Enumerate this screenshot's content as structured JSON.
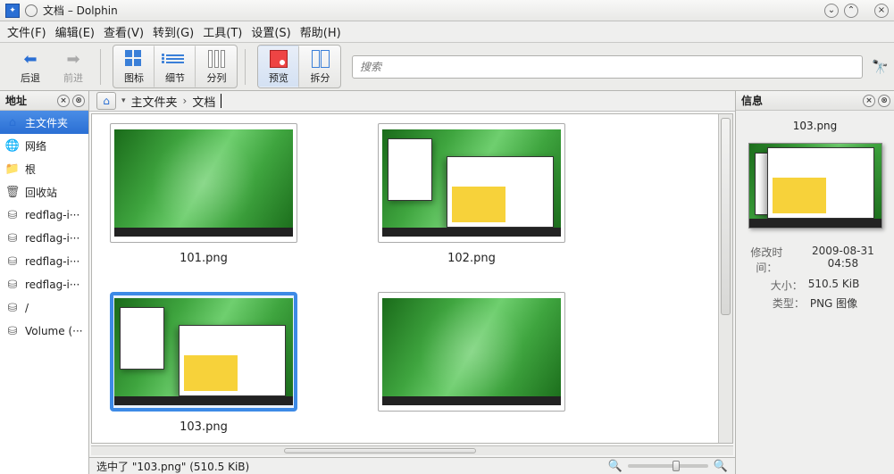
{
  "titlebar": {
    "title": "文档 – Dolphin"
  },
  "menu": {
    "file": "文件(F)",
    "edit": "编辑(E)",
    "view": "查看(V)",
    "go": "转到(G)",
    "tools": "工具(T)",
    "settings": "设置(S)",
    "help": "帮助(H)"
  },
  "toolbar": {
    "back": "后退",
    "forward": "前进",
    "icons": "图标",
    "details": "细节",
    "columns": "分列",
    "preview": "预览",
    "split": "拆分"
  },
  "search": {
    "placeholder": "搜索"
  },
  "sidebar": {
    "title": "地址",
    "items": [
      {
        "label": "主文件夹",
        "icon": "home",
        "selected": true
      },
      {
        "label": "网络",
        "icon": "globe"
      },
      {
        "label": "根",
        "icon": "folder"
      },
      {
        "label": "回收站",
        "icon": "trash"
      },
      {
        "label": "redflag-i···",
        "icon": "disk"
      },
      {
        "label": "redflag-i···",
        "icon": "disk"
      },
      {
        "label": "redflag-i···",
        "icon": "disk"
      },
      {
        "label": "redflag-i···",
        "icon": "disk"
      },
      {
        "label": "/",
        "icon": "disk"
      },
      {
        "label": "Volume (···",
        "icon": "disk"
      }
    ]
  },
  "breadcrumb": {
    "seg1": "主文件夹",
    "seg2": "文档"
  },
  "files": [
    {
      "name": "101.png",
      "kind": "leaf",
      "selected": false
    },
    {
      "name": "102.png",
      "kind": "wins",
      "selected": false
    },
    {
      "name": "103.png",
      "kind": "wins",
      "selected": true
    },
    {
      "name": "",
      "kind": "leaf",
      "selected": false
    }
  ],
  "info": {
    "title": "信息",
    "filename": "103.png",
    "mtime_label": "修改时间：",
    "mtime": "2009-08-31 04:58",
    "size_label": "大小：",
    "size": "510.5 KiB",
    "type_label": "类型：",
    "type": "PNG 图像"
  },
  "status": {
    "text": "选中了 \"103.png\" (510.5 KiB)"
  }
}
